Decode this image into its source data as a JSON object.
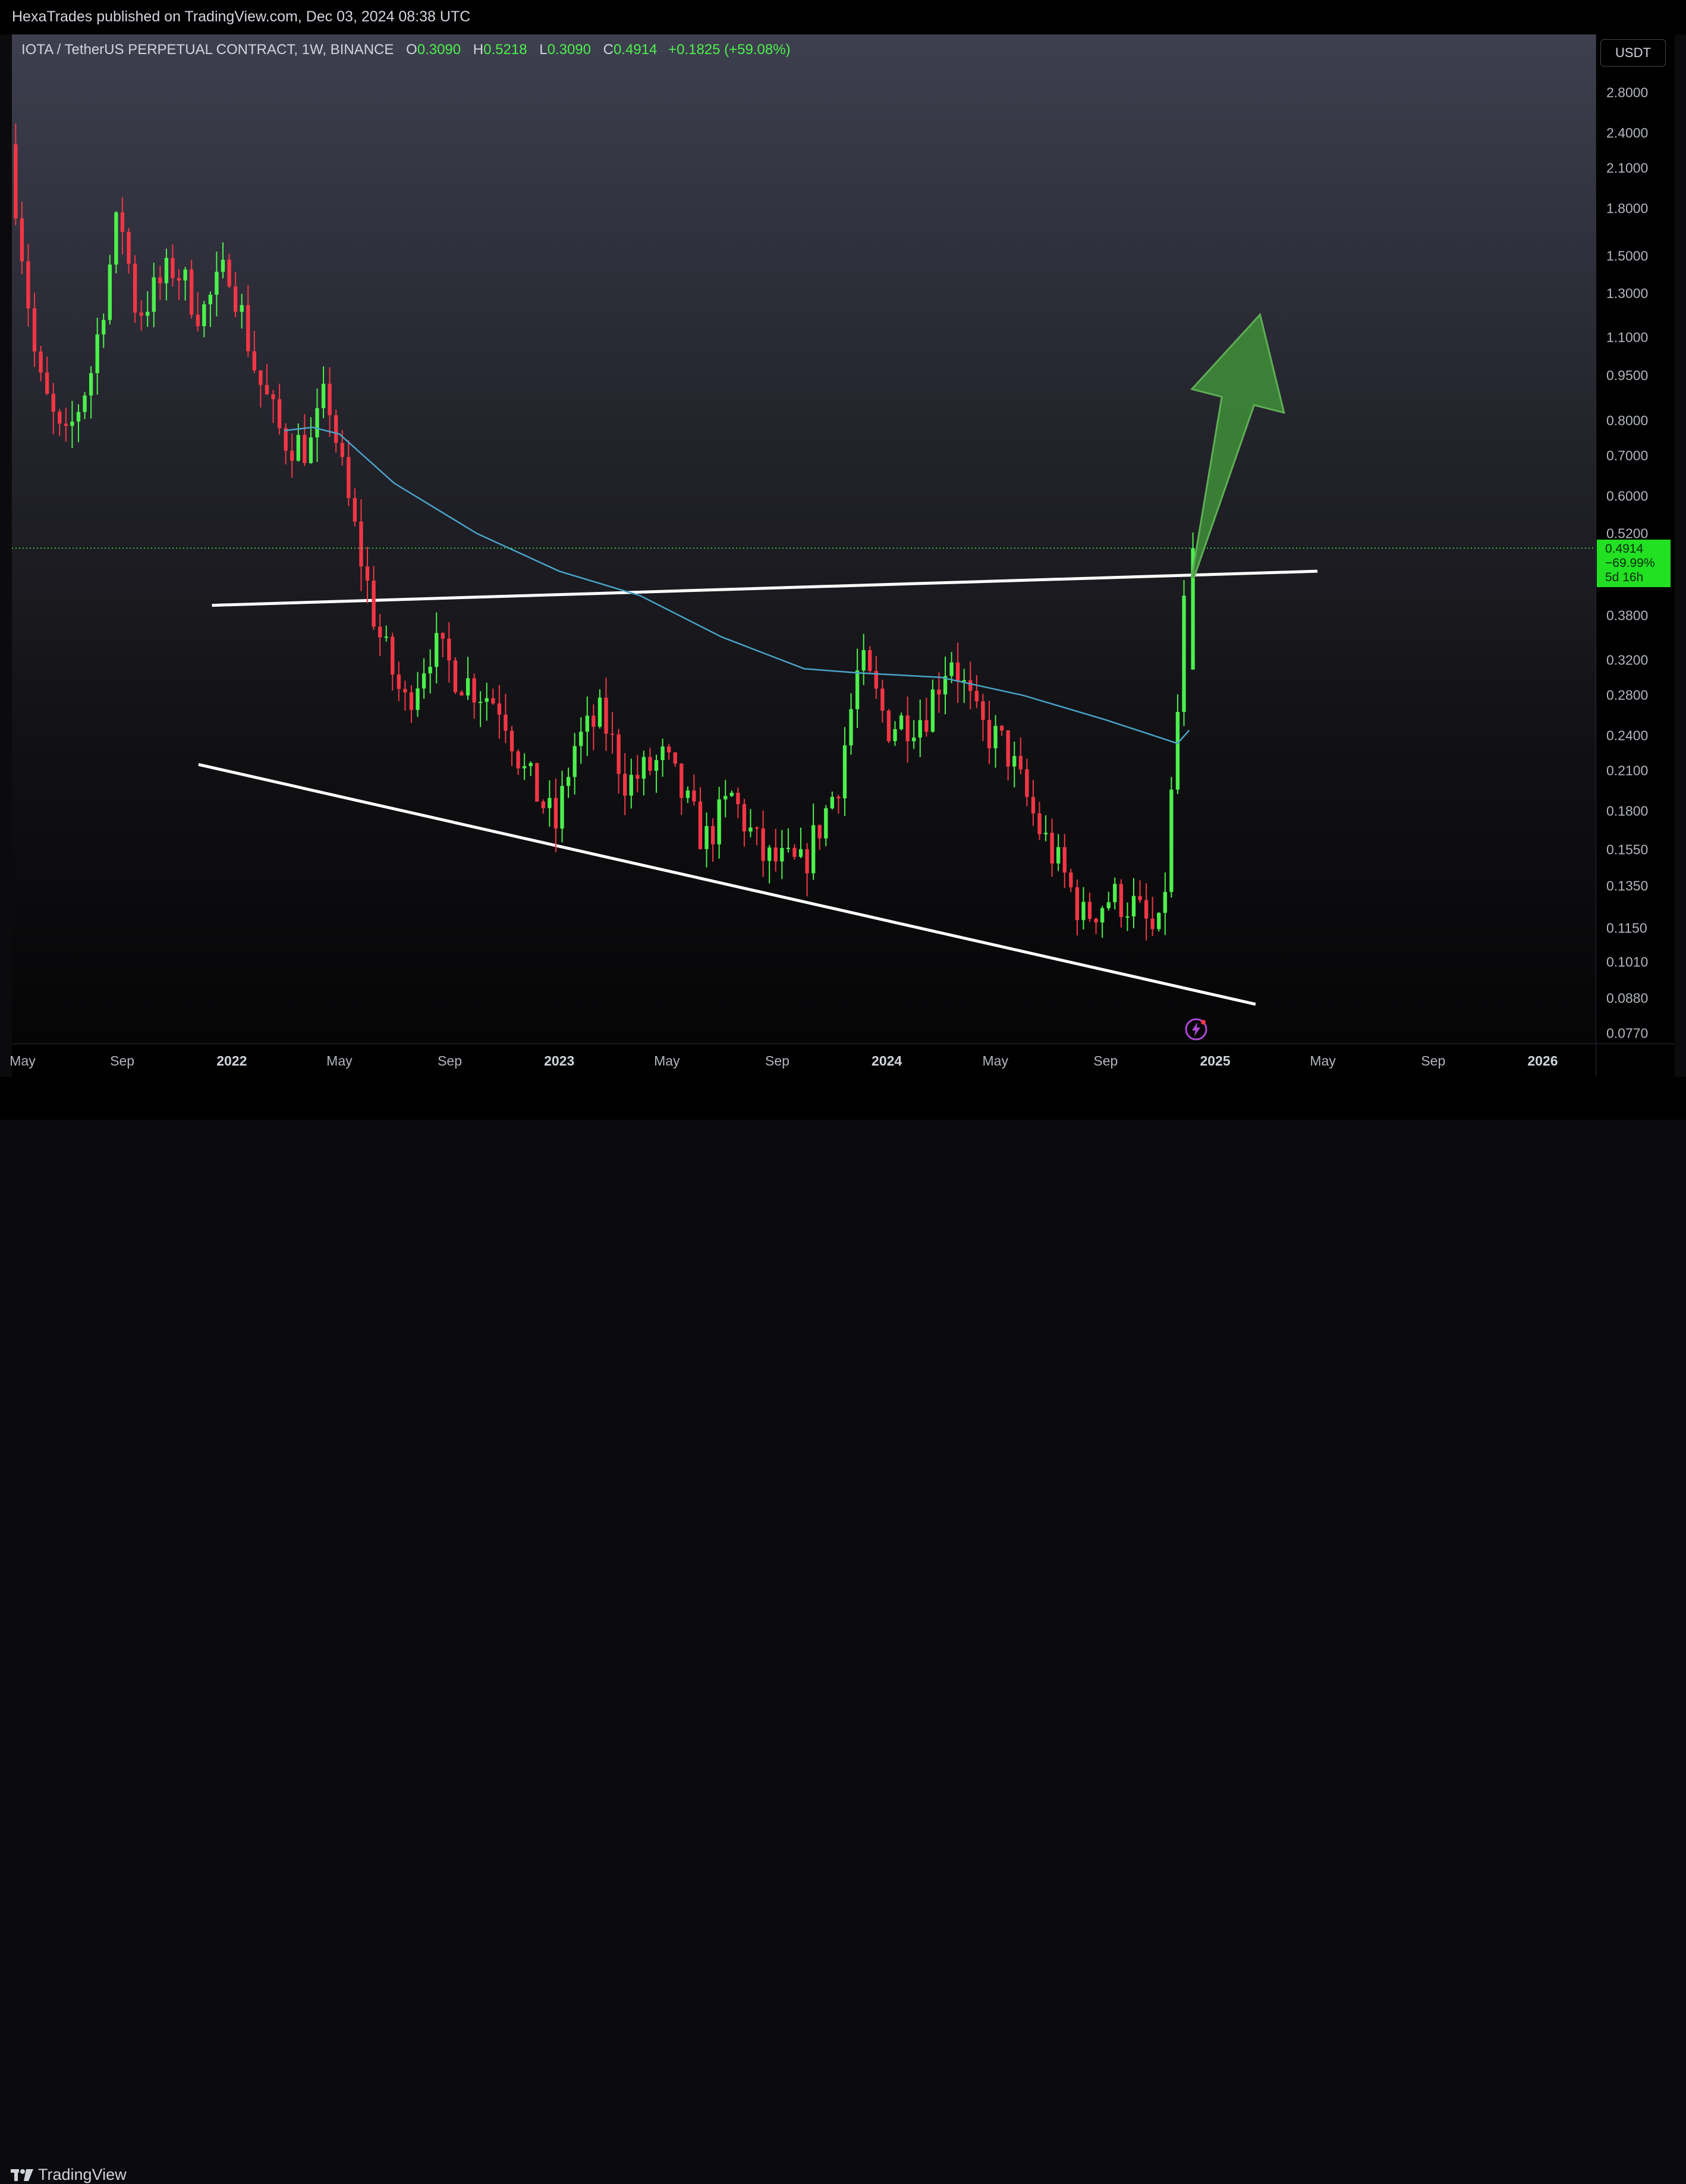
{
  "header": {
    "published": "HexaTrades published on TradingView.com, Dec 03, 2024 08:38 UTC"
  },
  "legend": {
    "symbol": "IOTA / TetherUS PERPETUAL CONTRACT, 1W, BINANCE",
    "open_label": "O",
    "open": "0.3090",
    "high_label": "H",
    "high": "0.5218",
    "low_label": "L",
    "low": "0.3090",
    "close_label": "C",
    "close": "0.4914",
    "change": "+0.1825 (+59.08%)"
  },
  "price_scale": {
    "currency": "USDT",
    "ticks": [
      "2.8000",
      "2.4000",
      "2.1000",
      "1.8000",
      "1.5000",
      "1.3000",
      "1.1000",
      "0.9500",
      "0.8000",
      "0.7000",
      "0.6000",
      "0.5200",
      "0.3800",
      "0.3200",
      "0.2800",
      "0.2400",
      "0.2100",
      "0.1800",
      "0.1550",
      "0.1350",
      "0.1150",
      "0.1010",
      "0.0880",
      "0.0770"
    ],
    "current_price": {
      "value": "0.4914",
      "change": "−69.99%",
      "countdown": "5d 16h"
    }
  },
  "time_scale": {
    "labels": [
      "May",
      "Sep",
      "2022",
      "May",
      "Sep",
      "2023",
      "May",
      "Sep",
      "2024",
      "May",
      "Sep",
      "2025",
      "May",
      "Sep",
      "2026"
    ],
    "bold": [
      false,
      false,
      true,
      false,
      false,
      true,
      false,
      false,
      true,
      false,
      false,
      true,
      false,
      false,
      true
    ]
  },
  "footer": {
    "brand": "TradingView"
  },
  "icons": [
    "tradingview-logo-icon",
    "lightning-bolt-icon",
    "up-arrow-icon"
  ],
  "colors": {
    "bull": "#4cf04c",
    "bear": "#f23645",
    "ma_line": "#4aa3c8",
    "trendline": "#ffffff",
    "arrow_fill": "#3f8f3a",
    "price_label_bg": "#22e022"
  },
  "chart_data": {
    "type": "candlestick",
    "title": "IOTA / TetherUS PERPETUAL CONTRACT, 1W, BINANCE",
    "y_scale": "log",
    "ylim": [
      0.074,
      3.5
    ],
    "xlim": [
      "2021-05-01",
      "2026-03-01"
    ],
    "grid": false,
    "last_candle": {
      "open": 0.309,
      "high": 0.5218,
      "low": 0.309,
      "close": 0.4914
    },
    "price_path": [
      [
        "2021-05-01",
        2.3
      ],
      [
        "2021-06-01",
        0.95
      ],
      [
        "2021-07-01",
        0.72
      ],
      [
        "2021-08-01",
        0.98
      ],
      [
        "2021-09-01",
        1.8
      ],
      [
        "2021-09-20",
        1.2
      ],
      [
        "2021-11-01",
        1.45
      ],
      [
        "2021-12-01",
        1.2
      ],
      [
        "2022-01-01",
        1.45
      ],
      [
        "2022-02-01",
        0.95
      ],
      [
        "2022-03-01",
        0.75
      ],
      [
        "2022-04-01",
        0.72
      ],
      [
        "2022-04-20",
        0.9
      ],
      [
        "2022-05-10",
        0.62
      ],
      [
        "2022-06-15",
        0.36
      ],
      [
        "2022-07-15",
        0.27
      ],
      [
        "2022-08-15",
        0.34
      ],
      [
        "2022-09-15",
        0.3
      ],
      [
        "2022-11-01",
        0.27
      ],
      [
        "2022-11-25",
        0.21
      ],
      [
        "2022-12-31",
        0.17
      ],
      [
        "2023-01-20",
        0.23
      ],
      [
        "2023-02-20",
        0.26
      ],
      [
        "2023-03-20",
        0.2
      ],
      [
        "2023-05-01",
        0.22
      ],
      [
        "2023-06-15",
        0.16
      ],
      [
        "2023-07-15",
        0.19
      ],
      [
        "2023-08-20",
        0.15
      ],
      [
        "2023-10-01",
        0.145
      ],
      [
        "2023-11-10",
        0.2
      ],
      [
        "2023-12-05",
        0.32
      ],
      [
        "2024-01-05",
        0.25
      ],
      [
        "2024-02-15",
        0.26
      ],
      [
        "2024-03-15",
        0.33
      ],
      [
        "2024-04-15",
        0.25
      ],
      [
        "2024-05-15",
        0.23
      ],
      [
        "2024-06-20",
        0.17
      ],
      [
        "2024-07-20",
        0.14
      ],
      [
        "2024-08-10",
        0.12
      ],
      [
        "2024-09-10",
        0.13
      ],
      [
        "2024-10-05",
        0.125
      ],
      [
        "2024-11-01",
        0.11
      ],
      [
        "2024-11-10",
        0.14
      ],
      [
        "2024-11-20",
        0.23
      ],
      [
        "2024-11-27",
        0.31
      ],
      [
        "2024-12-03",
        0.4914
      ]
    ],
    "moving_average": [
      [
        "2022-03-01",
        0.77
      ],
      [
        "2022-04-01",
        0.78
      ],
      [
        "2022-05-01",
        0.76
      ],
      [
        "2022-07-01",
        0.63
      ],
      [
        "2022-10-01",
        0.52
      ],
      [
        "2023-01-01",
        0.45
      ],
      [
        "2023-04-01",
        0.41
      ],
      [
        "2023-07-01",
        0.35
      ],
      [
        "2023-10-01",
        0.31
      ],
      [
        "2023-12-01",
        0.305
      ],
      [
        "2024-03-01",
        0.3
      ],
      [
        "2024-06-01",
        0.28
      ],
      [
        "2024-09-01",
        0.255
      ],
      [
        "2024-11-20",
        0.233
      ],
      [
        "2024-12-03",
        0.245
      ]
    ],
    "trendlines": [
      {
        "name": "resistance",
        "from": [
          "2021-12-10",
          0.395
        ],
        "to": [
          "2025-04-25",
          0.45
        ]
      },
      {
        "name": "support",
        "from": [
          "2021-11-25",
          0.215
        ],
        "to": [
          "2025-02-15",
          0.086
        ]
      }
    ],
    "arrow": {
      "from": [
        "2024-12-03",
        0.44
      ],
      "to": [
        "2025-02-20",
        1.2
      ]
    },
    "current_price_line": 0.4914
  }
}
